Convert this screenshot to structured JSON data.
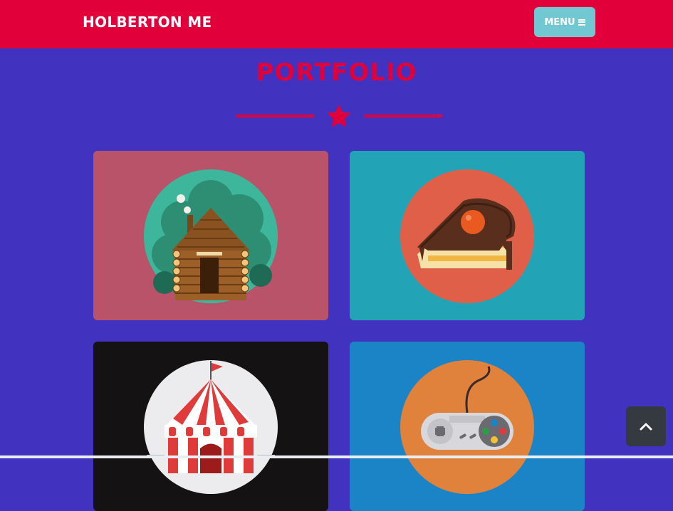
{
  "navbar": {
    "brand": "HOLBERTON ME",
    "menu_label": "MENU"
  },
  "section": {
    "title": "PORTFOLIO"
  },
  "portfolio": [
    {
      "name": "cabin",
      "bg_color": "#b95369",
      "circle_color": "#3eb69c"
    },
    {
      "name": "cake",
      "bg_color": "#23a4b6",
      "circle_color": "#e05f49"
    },
    {
      "name": "circus",
      "bg_color": "#141212",
      "circle_color": "#ecebed"
    },
    {
      "name": "game",
      "bg_color": "#1b84c7",
      "circle_color": "#e0813c"
    }
  ],
  "colors": {
    "navbar": "#e2003b",
    "background": "#4232c0",
    "accent": "#e2003b",
    "menu_button": "#72c8d2",
    "to_top_button": "#343a40"
  },
  "icons": {
    "menu": "bars-icon",
    "divider": "star-icon",
    "to_top": "chevron-up-icon"
  }
}
